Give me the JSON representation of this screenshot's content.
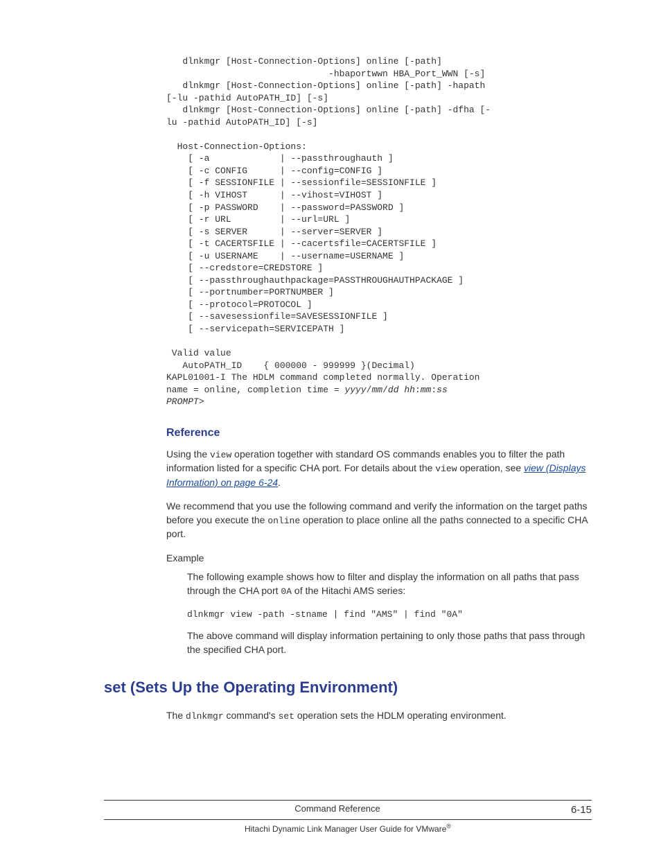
{
  "code_block": {
    "l01": "   dlnkmgr [Host-Connection-Options] online [-path]",
    "l02": "                              -hbaportwwn HBA_Port_WWN [-s]",
    "l03": "   dlnkmgr [Host-Connection-Options] online [-path] -hapath ",
    "l04": "[-lu -pathid AutoPATH_ID] [-s]",
    "l05": "   dlnkmgr [Host-Connection-Options] online [-path] -dfha [-",
    "l06": "lu -pathid AutoPATH_ID] [-s]",
    "l07": "",
    "l08": "  Host-Connection-Options:",
    "l09": "    [ -a             | --passthroughauth ]",
    "l10": "    [ -c CONFIG      | --config=CONFIG ]",
    "l11": "    [ -f SESSIONFILE | --sessionfile=SESSIONFILE ]",
    "l12": "    [ -h VIHOST      | --vihost=VIHOST ]",
    "l13": "    [ -p PASSWORD    | --password=PASSWORD ]",
    "l14": "    [ -r URL         | --url=URL ]",
    "l15": "    [ -s SERVER      | --server=SERVER ]",
    "l16": "    [ -t CACERTSFILE | --cacertsfile=CACERTSFILE ]",
    "l17": "    [ -u USERNAME    | --username=USERNAME ]",
    "l18": "    [ --credstore=CREDSTORE ]",
    "l19": "    [ --passthroughauthpackage=PASSTHROUGHAUTHPACKAGE ]",
    "l20": "    [ --portnumber=PORTNUMBER ]",
    "l21": "    [ --protocol=PROTOCOL ]",
    "l22": "    [ --savesessionfile=SAVESESSIONFILE ]",
    "l23": "    [ --servicepath=SERVICEPATH ]",
    "l24": "",
    "l25": " Valid value",
    "l26": "   AutoPATH_ID    { 000000 - 999999 }(Decimal)",
    "l27a": "KAPL01001-I The HDLM command completed normally. Operation ",
    "l27b": "name = online, completion time = ",
    "ts1": "yyyy",
    "ts2": "mm",
    "ts3": "dd",
    "ts4": "hh",
    "ts5": "mm",
    "ts6": "ss",
    "prompt": "PROMPT",
    "gt": ">"
  },
  "section": {
    "reference_heading": "Reference",
    "p1_a": "Using the ",
    "p1_code1": "view",
    "p1_b": " operation together with standard OS commands enables you to filter the path information listed for a specific CHA port. For details about the ",
    "p1_code2": "view",
    "p1_c": " operation, see ",
    "p1_link": "view (Displays Information) on page 6-24",
    "p1_d": ".",
    "p2_a": "We recommend that you use the following command and verify the information on the target paths before you execute the ",
    "p2_code": "online",
    "p2_b": " operation to place online all the paths connected to a specific CHA port.",
    "example_label": "Example",
    "example_p1_a": "The following example shows how to filter and display the information on all paths that pass through the CHA port ",
    "example_p1_code": "0A",
    "example_p1_b": " of the Hitachi AMS series:",
    "example_cmd": "dlnkmgr view -path -stname | find \"AMS\" | find \"0A\"",
    "example_p2": "The above command will display information pertaining to only those paths that pass through the specified CHA port."
  },
  "h1": "set (Sets Up the Operating Environment)",
  "h1_para_a": "The ",
  "h1_code1": "dlnkmgr",
  "h1_para_b": " command's ",
  "h1_code2": "set",
  "h1_para_c": " operation sets the HDLM operating environment.",
  "footer": {
    "center1": "Command Reference",
    "pagenum": "6-15",
    "center2_a": "Hitachi Dynamic Link Manager User Guide for VMware",
    "center2_sup": "®"
  }
}
